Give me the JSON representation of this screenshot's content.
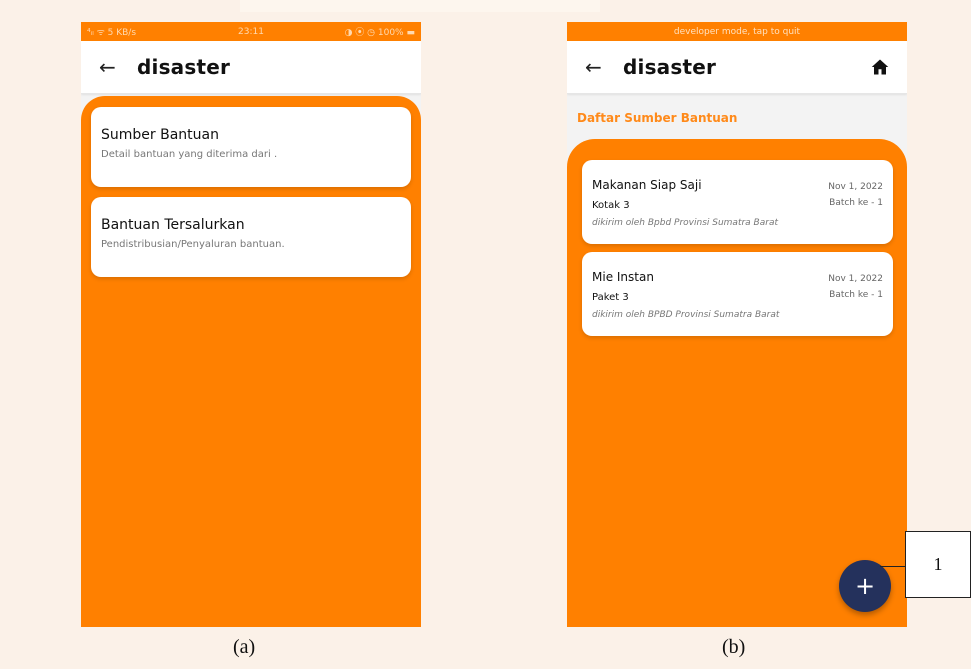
{
  "screen_a": {
    "status_bar": {
      "left": "⁴ᵢₗ ᯤ 5 KB/s",
      "time": "23:11",
      "right": "◑ ⦿ ◷ 100% ▬"
    },
    "app_bar": {
      "title": "disaster"
    },
    "menu": [
      {
        "title": "Sumber Bantuan",
        "description": "Detail bantuan yang diterima dari ."
      },
      {
        "title": "Bantuan Tersalurkan",
        "description": "Pendistribusian/Penyaluran bantuan."
      }
    ],
    "caption": "(a)"
  },
  "screen_b": {
    "dev_banner": "developer mode, tap to quit",
    "app_bar": {
      "title": "disaster"
    },
    "section_title": "Daftar Sumber Bantuan",
    "items": [
      {
        "name": "Makanan Siap Saji",
        "quantity": "Kotak 3",
        "sender": "dikirim oleh Bpbd Provinsi Sumatra Barat",
        "date": "Nov 1, 2022",
        "batch": "Batch ke - 1"
      },
      {
        "name": "Mie Instan",
        "quantity": "Paket 3",
        "sender": "dikirim oleh BPBD Provinsi Sumatra Barat",
        "date": "Nov 1, 2022",
        "batch": "Batch ke - 1"
      }
    ],
    "fab_label": "+",
    "caption": "(b)"
  },
  "callout": {
    "label": "1"
  },
  "colors": {
    "accent": "#ff8000",
    "fab": "#24315c",
    "section_title": "#ff8a1a",
    "page_bg": "#fbf1e8"
  },
  "icons": {
    "back": "arrow-left-icon",
    "home": "home-icon",
    "add": "plus-icon"
  }
}
